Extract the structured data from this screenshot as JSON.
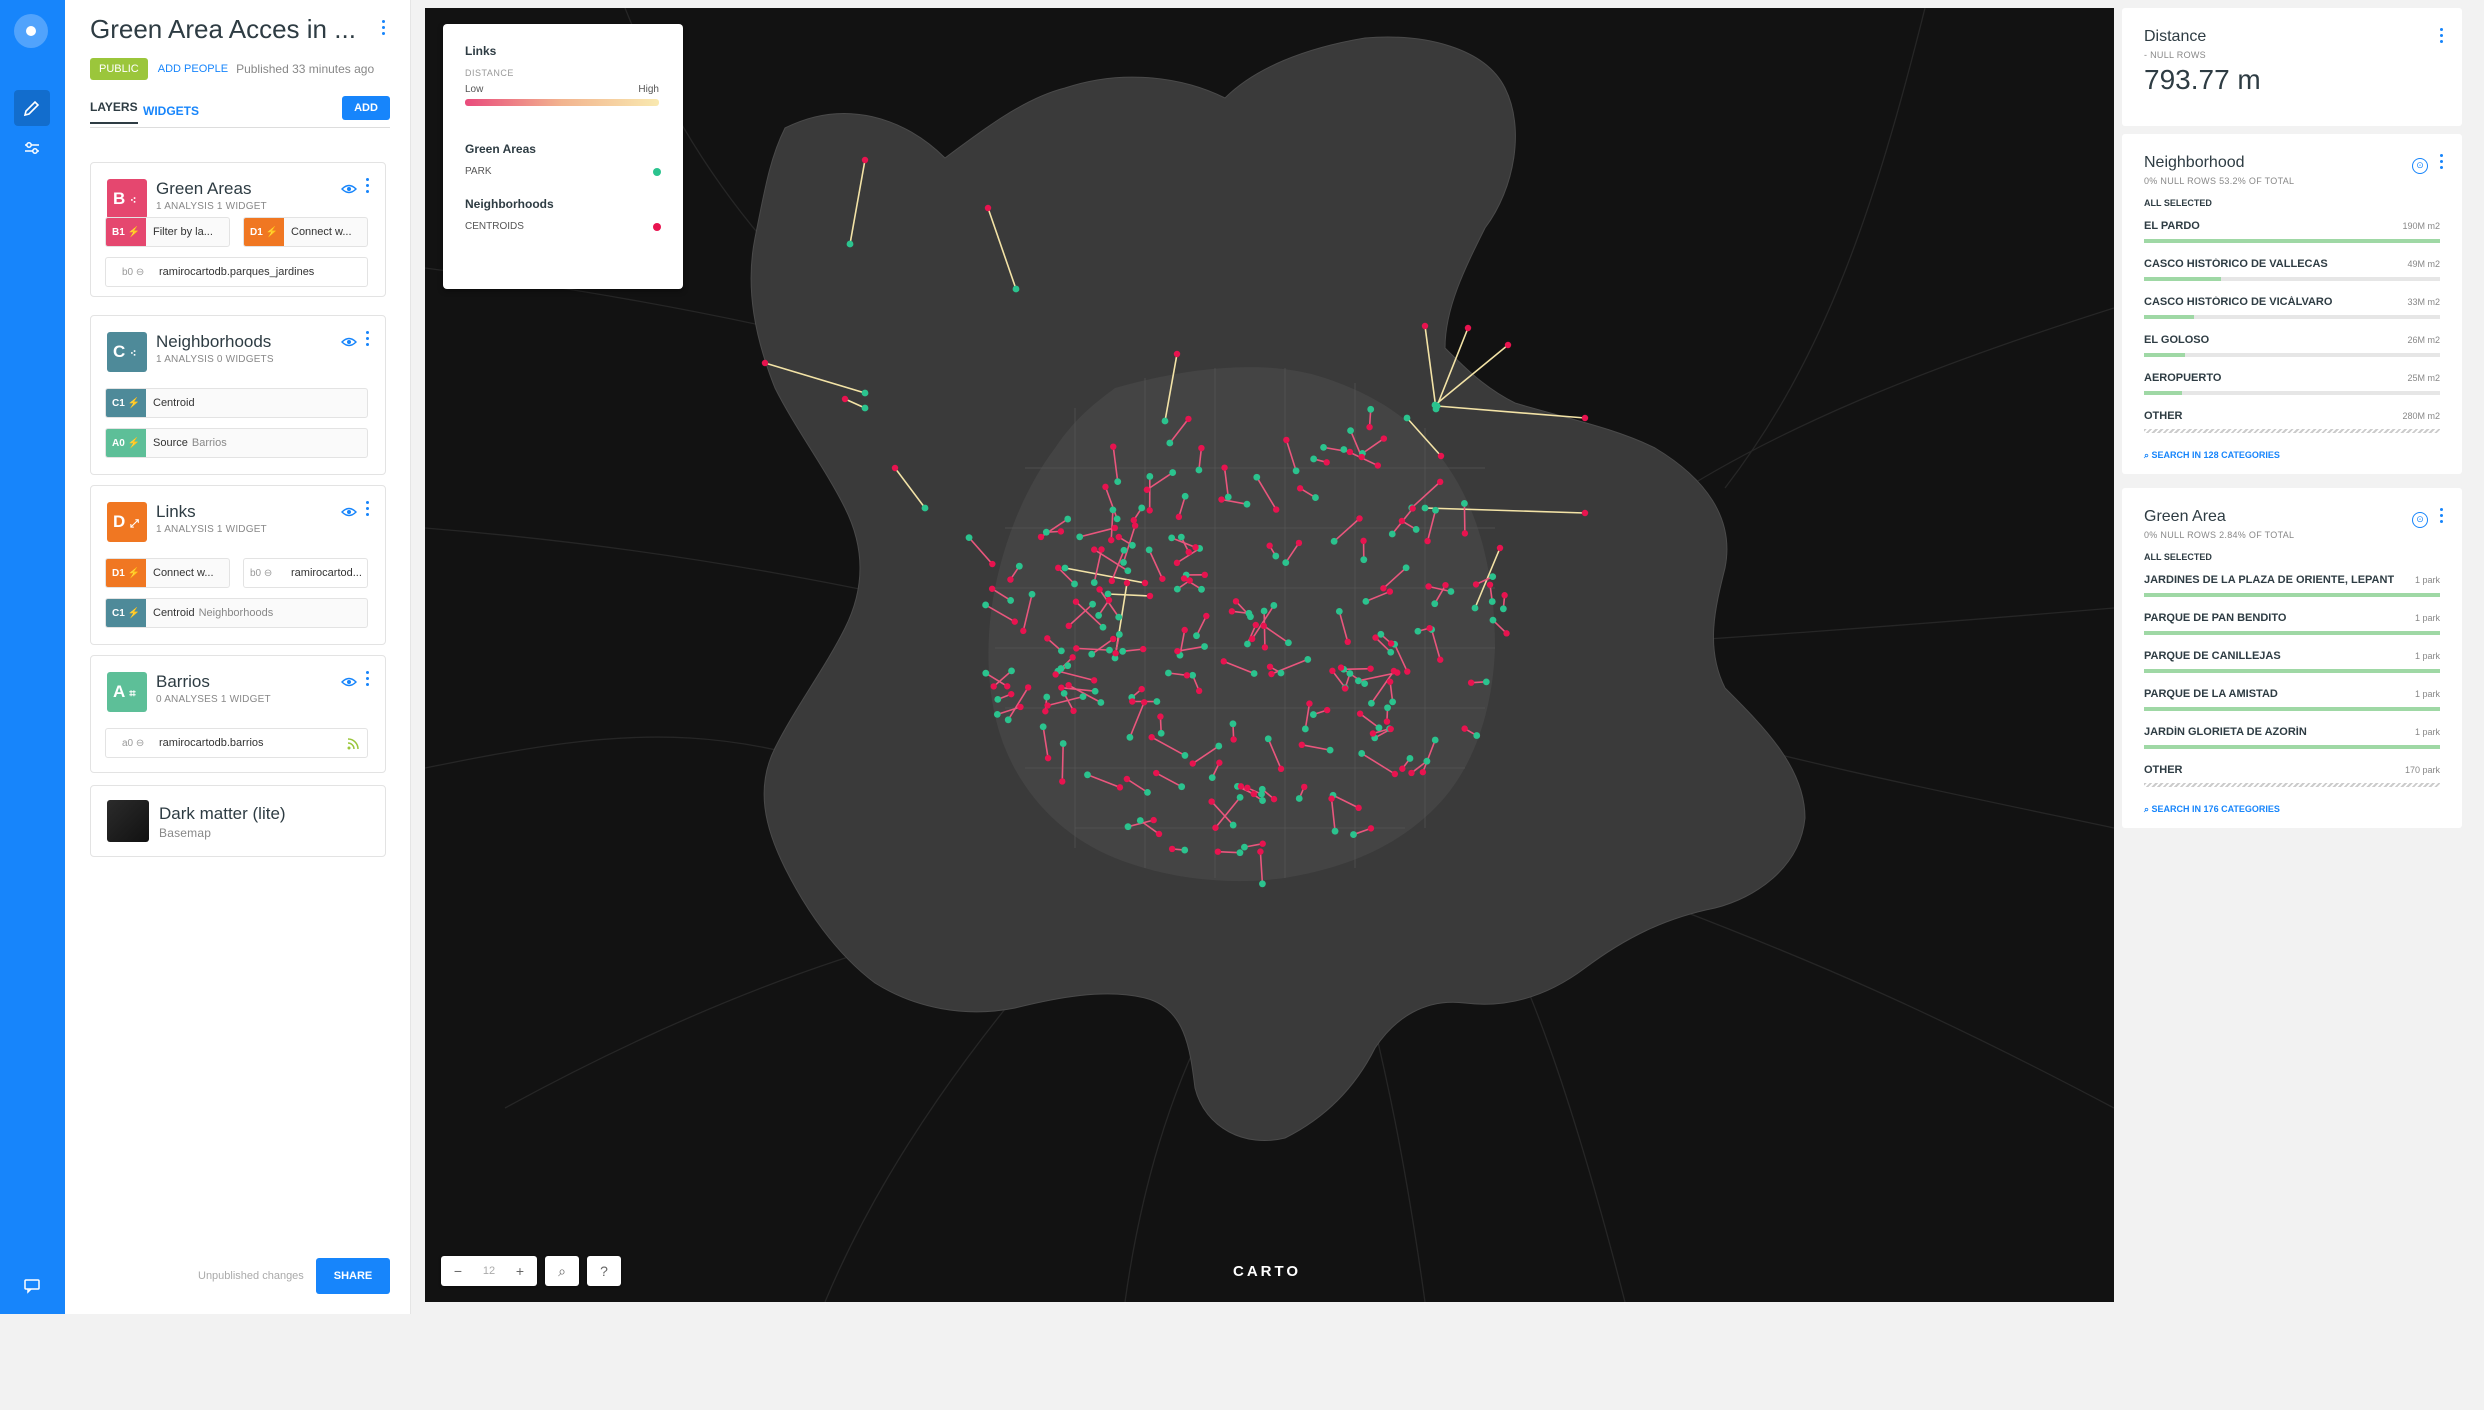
{
  "app": {
    "title": "Green Area Acces in ...",
    "visibility": "PUBLIC",
    "add_people": "ADD PEOPLE",
    "published": "Published 33 minutes ago"
  },
  "tabs": {
    "layers": "LAYERS",
    "widgets": "WIDGETS",
    "add": "ADD"
  },
  "layers": [
    {
      "letter": "B",
      "name": "Green Areas",
      "meta": "1 ANALYSIS   1 WIDGET",
      "color": "#e5476f",
      "nodes": [
        {
          "id": "B1",
          "label": "Filter by la...",
          "color": "#e5476f"
        },
        {
          "id": "D1",
          "label": "Connect w...",
          "color": "#f07722"
        },
        {
          "id": "b0",
          "label": "ramirocartodb.parques_jardines"
        }
      ]
    },
    {
      "letter": "C",
      "name": "Neighborhoods",
      "meta": "1 ANALYSIS   0 WIDGETS",
      "color": "#4e8a99",
      "nodes": [
        {
          "id": "C1",
          "label": "Centroid",
          "color": "#4e8a99"
        },
        {
          "id": "A0",
          "label": "Source",
          "sub": "Barrios",
          "color": "#5dbf98"
        }
      ]
    },
    {
      "letter": "D",
      "name": "Links",
      "meta": "1 ANALYSIS   1 WIDGET",
      "color": "#f07722",
      "nodes": [
        {
          "id": "D1",
          "label": "Connect w...",
          "color": "#f07722"
        },
        {
          "id": "b0",
          "label": "ramirocartod..."
        },
        {
          "id": "C1",
          "label": "Centroid",
          "sub": "Neighborhoods",
          "color": "#4e8a99"
        }
      ]
    },
    {
      "letter": "A",
      "name": "Barrios",
      "meta": "0 ANALYSES   1 WIDGET",
      "color": "#5dbf98",
      "nodes": [
        {
          "id": "a0",
          "label": "ramirocartodb.barrios"
        }
      ]
    }
  ],
  "basemap": {
    "name": "Dark matter (lite)",
    "sub": "Basemap"
  },
  "footer": {
    "unpublished": "Unpublished changes",
    "share": "SHARE"
  },
  "legend": {
    "links_title": "Links",
    "distance_label": "DISTANCE",
    "low": "Low",
    "high": "High",
    "green_areas_title": "Green Areas",
    "park_label": "PARK",
    "park_color": "#2bc38e",
    "neighborhoods_title": "Neighborhoods",
    "centroids_label": "CENTROIDS",
    "centroids_color": "#e8134f"
  },
  "map_controls": {
    "zoom": "12",
    "minus": "−",
    "plus": "+",
    "search": "⌕",
    "help": "?"
  },
  "carto_logo": "CARTO",
  "widgets": {
    "distance": {
      "title": "Distance",
      "sub": "- NULL ROWS",
      "value": "793.77 m"
    },
    "neighborhood": {
      "title": "Neighborhood",
      "sub": "0% NULL ROWS     53.2% OF TOTAL",
      "all_selected": "ALL SELECTED",
      "rows": [
        {
          "name": "EL PARDO",
          "value": "190M m2",
          "fraction": 1.0
        },
        {
          "name": "CASCO HISTÓRICO DE VALLECAS",
          "value": "49M m2",
          "fraction": 0.26
        },
        {
          "name": "CASCO HISTÓRICO DE VICÁLVARO",
          "value": "33M m2",
          "fraction": 0.17
        },
        {
          "name": "EL GOLOSO",
          "value": "26M m2",
          "fraction": 0.14
        },
        {
          "name": "AEROPUERTO",
          "value": "25M m2",
          "fraction": 0.13
        },
        {
          "name": "OTHER",
          "value": "280M m2",
          "fraction": 1.0
        }
      ],
      "search": "SEARCH IN 128 CATEGORIES"
    },
    "green_area": {
      "title": "Green Area",
      "sub": "0% NULL ROWS     2.84% OF TOTAL",
      "all_selected": "ALL SELECTED",
      "rows": [
        {
          "name": "JARDINES DE LA PLAZA DE ORIENTE, LEPANTO...",
          "value": "1 park",
          "fraction": 1.0
        },
        {
          "name": "PARQUE DE PAN BENDITO",
          "value": "1 park",
          "fraction": 1.0
        },
        {
          "name": "PARQUE DE CANILLEJAS",
          "value": "1 park",
          "fraction": 1.0
        },
        {
          "name": "PARQUE DE LA AMISTAD",
          "value": "1 park",
          "fraction": 1.0
        },
        {
          "name": "JARDÍN GLORIETA DE AZORÍN",
          "value": "1 park",
          "fraction": 1.0
        },
        {
          "name": "OTHER",
          "value": "170 park",
          "fraction": 1.0
        }
      ],
      "search": "SEARCH IN 176 CATEGORIES"
    }
  }
}
